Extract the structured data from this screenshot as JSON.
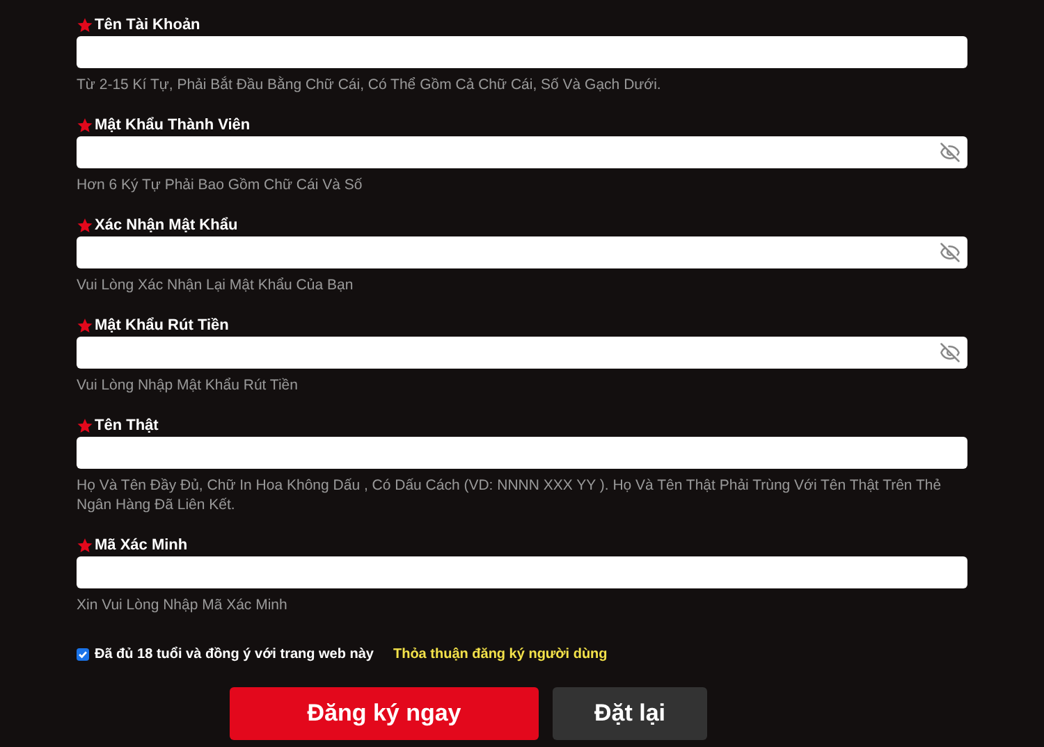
{
  "fields": [
    {
      "label": "Tên Tài Khoản",
      "kind": "text",
      "hint": "Từ 2-15 Kí Tự, Phải Bắt Đầu Bằng Chữ Cái, Có Thể Gồm Cả Chữ Cái, Số Và Gạch Dưới."
    },
    {
      "label": "Mật Khẩu Thành Viên",
      "kind": "password",
      "hint": "Hơn 6 Ký Tự Phải Bao Gồm Chữ Cái Và Số"
    },
    {
      "label": "Xác Nhận Mật Khẩu",
      "kind": "password",
      "hint": "Vui Lòng Xác Nhận Lại Mật Khẩu Của Bạn"
    },
    {
      "label": "Mật Khẩu Rút Tiền",
      "kind": "password",
      "hint": "Vui Lòng Nhập Mật Khẩu Rút Tiền"
    },
    {
      "label": "Tên Thật",
      "kind": "text",
      "hint": "Họ Và Tên Đầy Đủ, Chữ In Hoa Không Dấu , Có Dấu Cách (VD: NNNN XXX YY ). Họ Và Tên Thật Phải Trùng Với Tên Thật Trên Thẻ Ngân Hàng Đã Liên Kết."
    },
    {
      "label": "Mã Xác Minh",
      "kind": "text",
      "hint": "Xin Vui Lòng Nhập Mã Xác Minh"
    }
  ],
  "agreement": {
    "checked": true,
    "text": "Đã đủ 18 tuổi và đồng ý với trang web này",
    "link": "Thỏa thuận đăng ký người dùng"
  },
  "buttons": [
    {
      "label": "Đăng ký ngay",
      "kind": "primary"
    },
    {
      "label": "Đặt lại",
      "kind": "secondary"
    }
  ]
}
